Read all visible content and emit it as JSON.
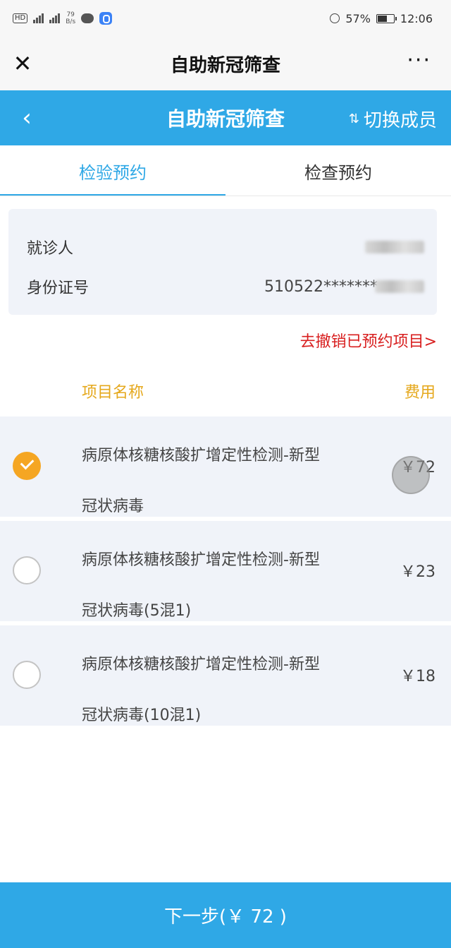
{
  "status_bar": {
    "hd": "HD",
    "net_a": "4G",
    "net_b": "4G",
    "speed_value": "79",
    "speed_unit": "B/s",
    "battery": "57%",
    "time": "12:06"
  },
  "wx_header": {
    "title": "自助新冠筛查",
    "close": "✕",
    "more": "···"
  },
  "app_header": {
    "back": "‹",
    "title": "自助新冠筛查",
    "switch_label": "切换成员"
  },
  "tabs": [
    {
      "label": "检验预约"
    },
    {
      "label": "检查预约"
    }
  ],
  "patient": {
    "name_label": "就诊人",
    "id_label": "身份证号",
    "id_value": "510522*******"
  },
  "cancel_link": "去撤销已预约项目>",
  "list_header": {
    "name": "项目名称",
    "fee": "费用"
  },
  "items": [
    {
      "line1": "病原体核糖核酸扩增定性检测-新型",
      "line2": "冠状病毒",
      "price": "￥72",
      "checked": true
    },
    {
      "line1": "病原体核糖核酸扩增定性检测-新型",
      "line2": "冠状病毒(5混1)",
      "price": "￥23",
      "checked": false
    },
    {
      "line1": "病原体核糖核酸扩增定性检测-新型",
      "line2": "冠状病毒(10混1)",
      "price": "￥18",
      "checked": false
    }
  ],
  "next_button": "下一步(￥ 72 )"
}
